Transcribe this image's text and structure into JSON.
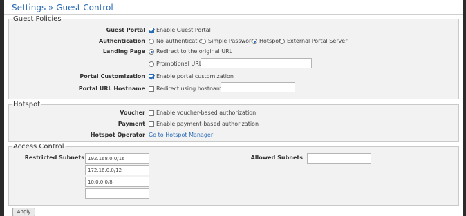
{
  "header": {
    "breadcrumb_parent": "Settings",
    "breadcrumb_sep": "»",
    "breadcrumb_current": "Guest Control"
  },
  "guest_policies": {
    "legend": "Guest Policies",
    "guest_portal": {
      "label": "Guest Portal",
      "option": "Enable Guest Portal",
      "checked": true
    },
    "authentication": {
      "label": "Authentication",
      "options": [
        "No authentication",
        "Simple Password",
        "Hotspot",
        "External Portal Server"
      ],
      "selected": "Hotspot"
    },
    "landing_page": {
      "label": "Landing Page",
      "redirect_option": "Redirect to the original URL",
      "promo_option": "Promotional URL",
      "selected": "Redirect to the original URL",
      "promo_value": ""
    },
    "portal_customization": {
      "label": "Portal Customization",
      "option": "Enable portal customization",
      "checked": true
    },
    "portal_url_hostname": {
      "label": "Portal URL Hostname",
      "option": "Redirect using hostname",
      "checked": false,
      "hostname_value": ""
    }
  },
  "hotspot": {
    "legend": "Hotspot",
    "voucher": {
      "label": "Voucher",
      "option": "Enable voucher-based authorization",
      "checked": false
    },
    "payment": {
      "label": "Payment",
      "option": "Enable payment-based authorization",
      "checked": false
    },
    "operator": {
      "label": "Hotspot Operator",
      "link": "Go to Hotspot Manager"
    }
  },
  "access_control": {
    "legend": "Access Control",
    "restricted_label": "Restricted Subnets",
    "restricted_subnets": [
      "192.168.0.0/16",
      "172.16.0.0/12",
      "10.0.0.0/8",
      ""
    ],
    "allowed_label": "Allowed Subnets",
    "allowed_subnets": [
      ""
    ]
  },
  "footer": {
    "apply_label": "Apply"
  },
  "colors": {
    "link": "#2a6bb5",
    "panel_bg": "#f2f2f2",
    "frame": "#2b2b2b"
  }
}
